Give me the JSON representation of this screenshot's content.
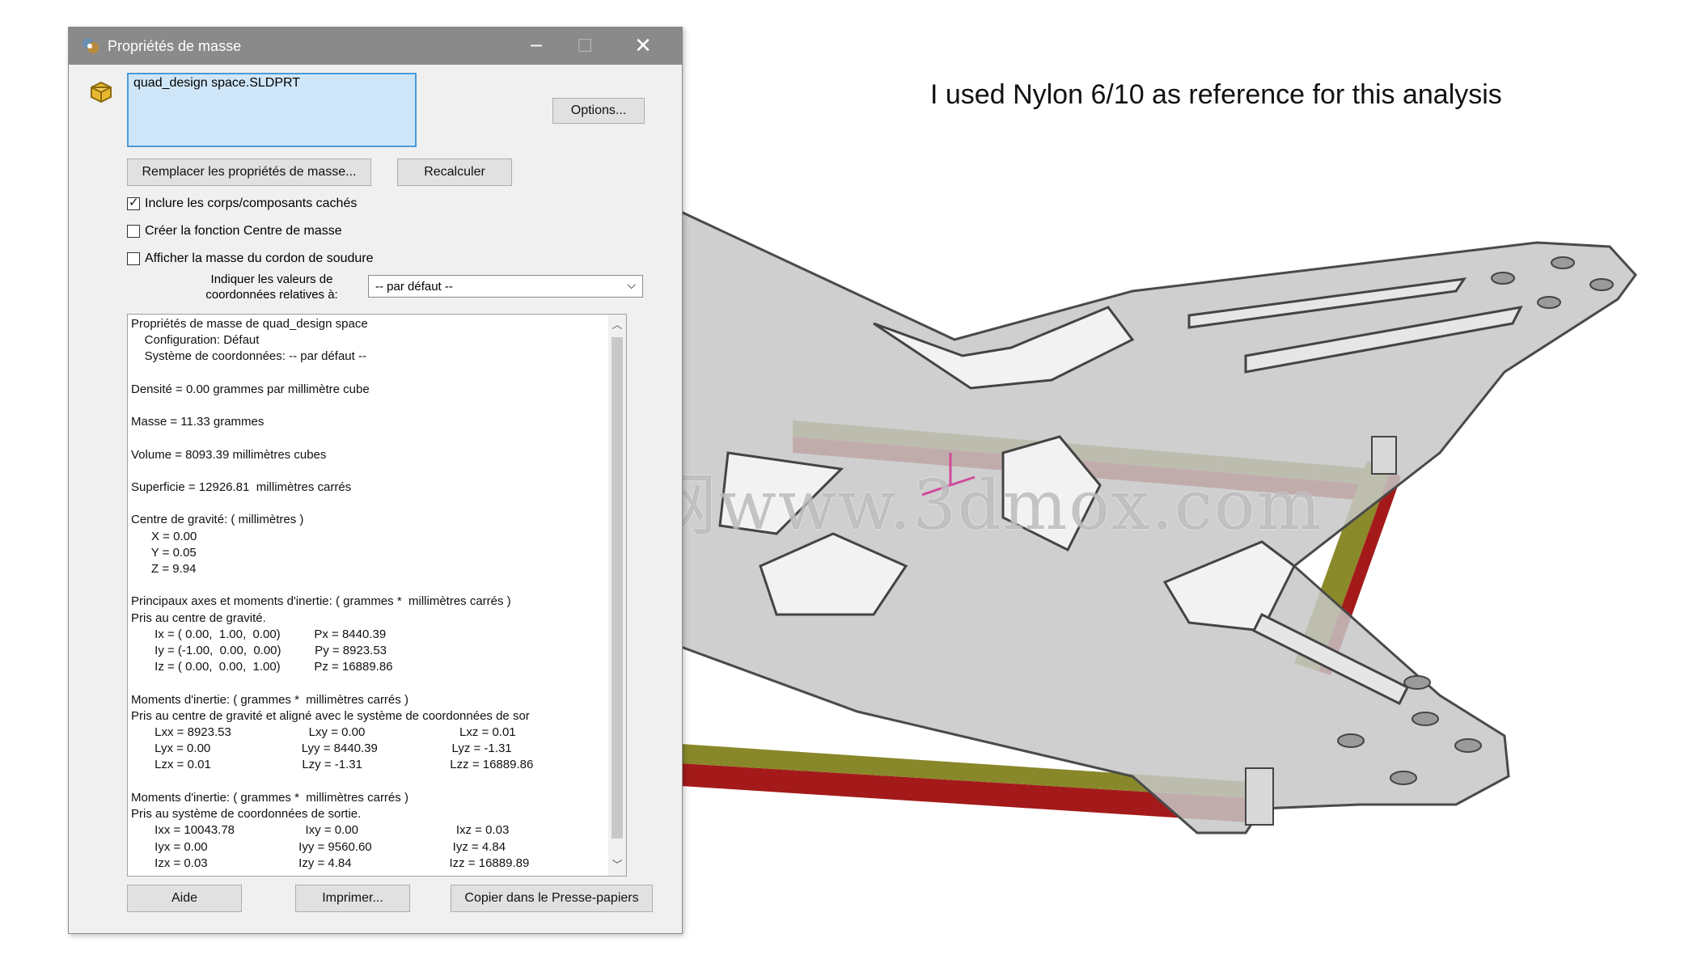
{
  "annotation": "I used Nylon 6/10 as reference for this analysis",
  "watermark": "莫西网www.3dmox.com",
  "dialog": {
    "title": "Propriétés de masse",
    "file_name": "quad_design space.SLDPRT",
    "options_button": "Options...",
    "override_button": "Remplacer les propriétés de masse...",
    "recalc_button": "Recalculer",
    "checkboxes": [
      {
        "label": "Inclure les corps/composants cachés",
        "checked": true
      },
      {
        "label": "Créer la fonction Centre de masse",
        "checked": false
      },
      {
        "label": "Afficher la masse du cordon de soudure",
        "checked": false
      }
    ],
    "coord_label": "Indiquer les valeurs de coordonnées relatives à:",
    "coord_select": "-- par défaut --",
    "results_lines": [
      "Propriétés de masse de quad_design space",
      "    Configuration: Défaut",
      "    Système de coordonnées: -- par défaut --",
      "",
      "Densité = 0.00 grammes par millimètre cube",
      "",
      "Masse = 11.33 grammes",
      "",
      "Volume = 8093.39 millimètres cubes",
      "",
      "Superficie = 12926.81  millimètres carrés",
      "",
      "Centre de gravité: ( millimètres )",
      "      X = 0.00",
      "      Y = 0.05",
      "      Z = 9.94",
      "",
      "Principaux axes et moments d'inertie: ( grammes *  millimètres carrés )",
      "Pris au centre de gravité.",
      "       Ix = ( 0.00,  1.00,  0.00)          Px = 8440.39",
      "       Iy = (-1.00,  0.00,  0.00)          Py = 8923.53",
      "       Iz = ( 0.00,  0.00,  1.00)          Pz = 16889.86",
      "",
      "Moments d'inertie: ( grammes *  millimètres carrés )",
      "Pris au centre de gravité et aligné avec le système de coordonnées de sor",
      "       Lxx = 8923.53                       Lxy = 0.00                            Lxz = 0.01",
      "       Lyx = 0.00                           Lyy = 8440.39                      Lyz = -1.31",
      "       Lzx = 0.01                           Lzy = -1.31                          Lzz = 16889.86",
      "",
      "Moments d'inertie: ( grammes *  millimètres carrés )",
      "Pris au système de coordonnées de sortie.",
      "       Ixx = 10043.78                     Ixy = 0.00                             Ixz = 0.03",
      "       Iyx = 0.00                           Iyy = 9560.60                        Iyz = 4.84",
      "       Izx = 0.03                           Izy = 4.84                             Izz = 16889.89"
    ],
    "help_button": "Aide",
    "print_button": "Imprimer...",
    "copy_button": "Copier dans le Presse-papiers"
  }
}
